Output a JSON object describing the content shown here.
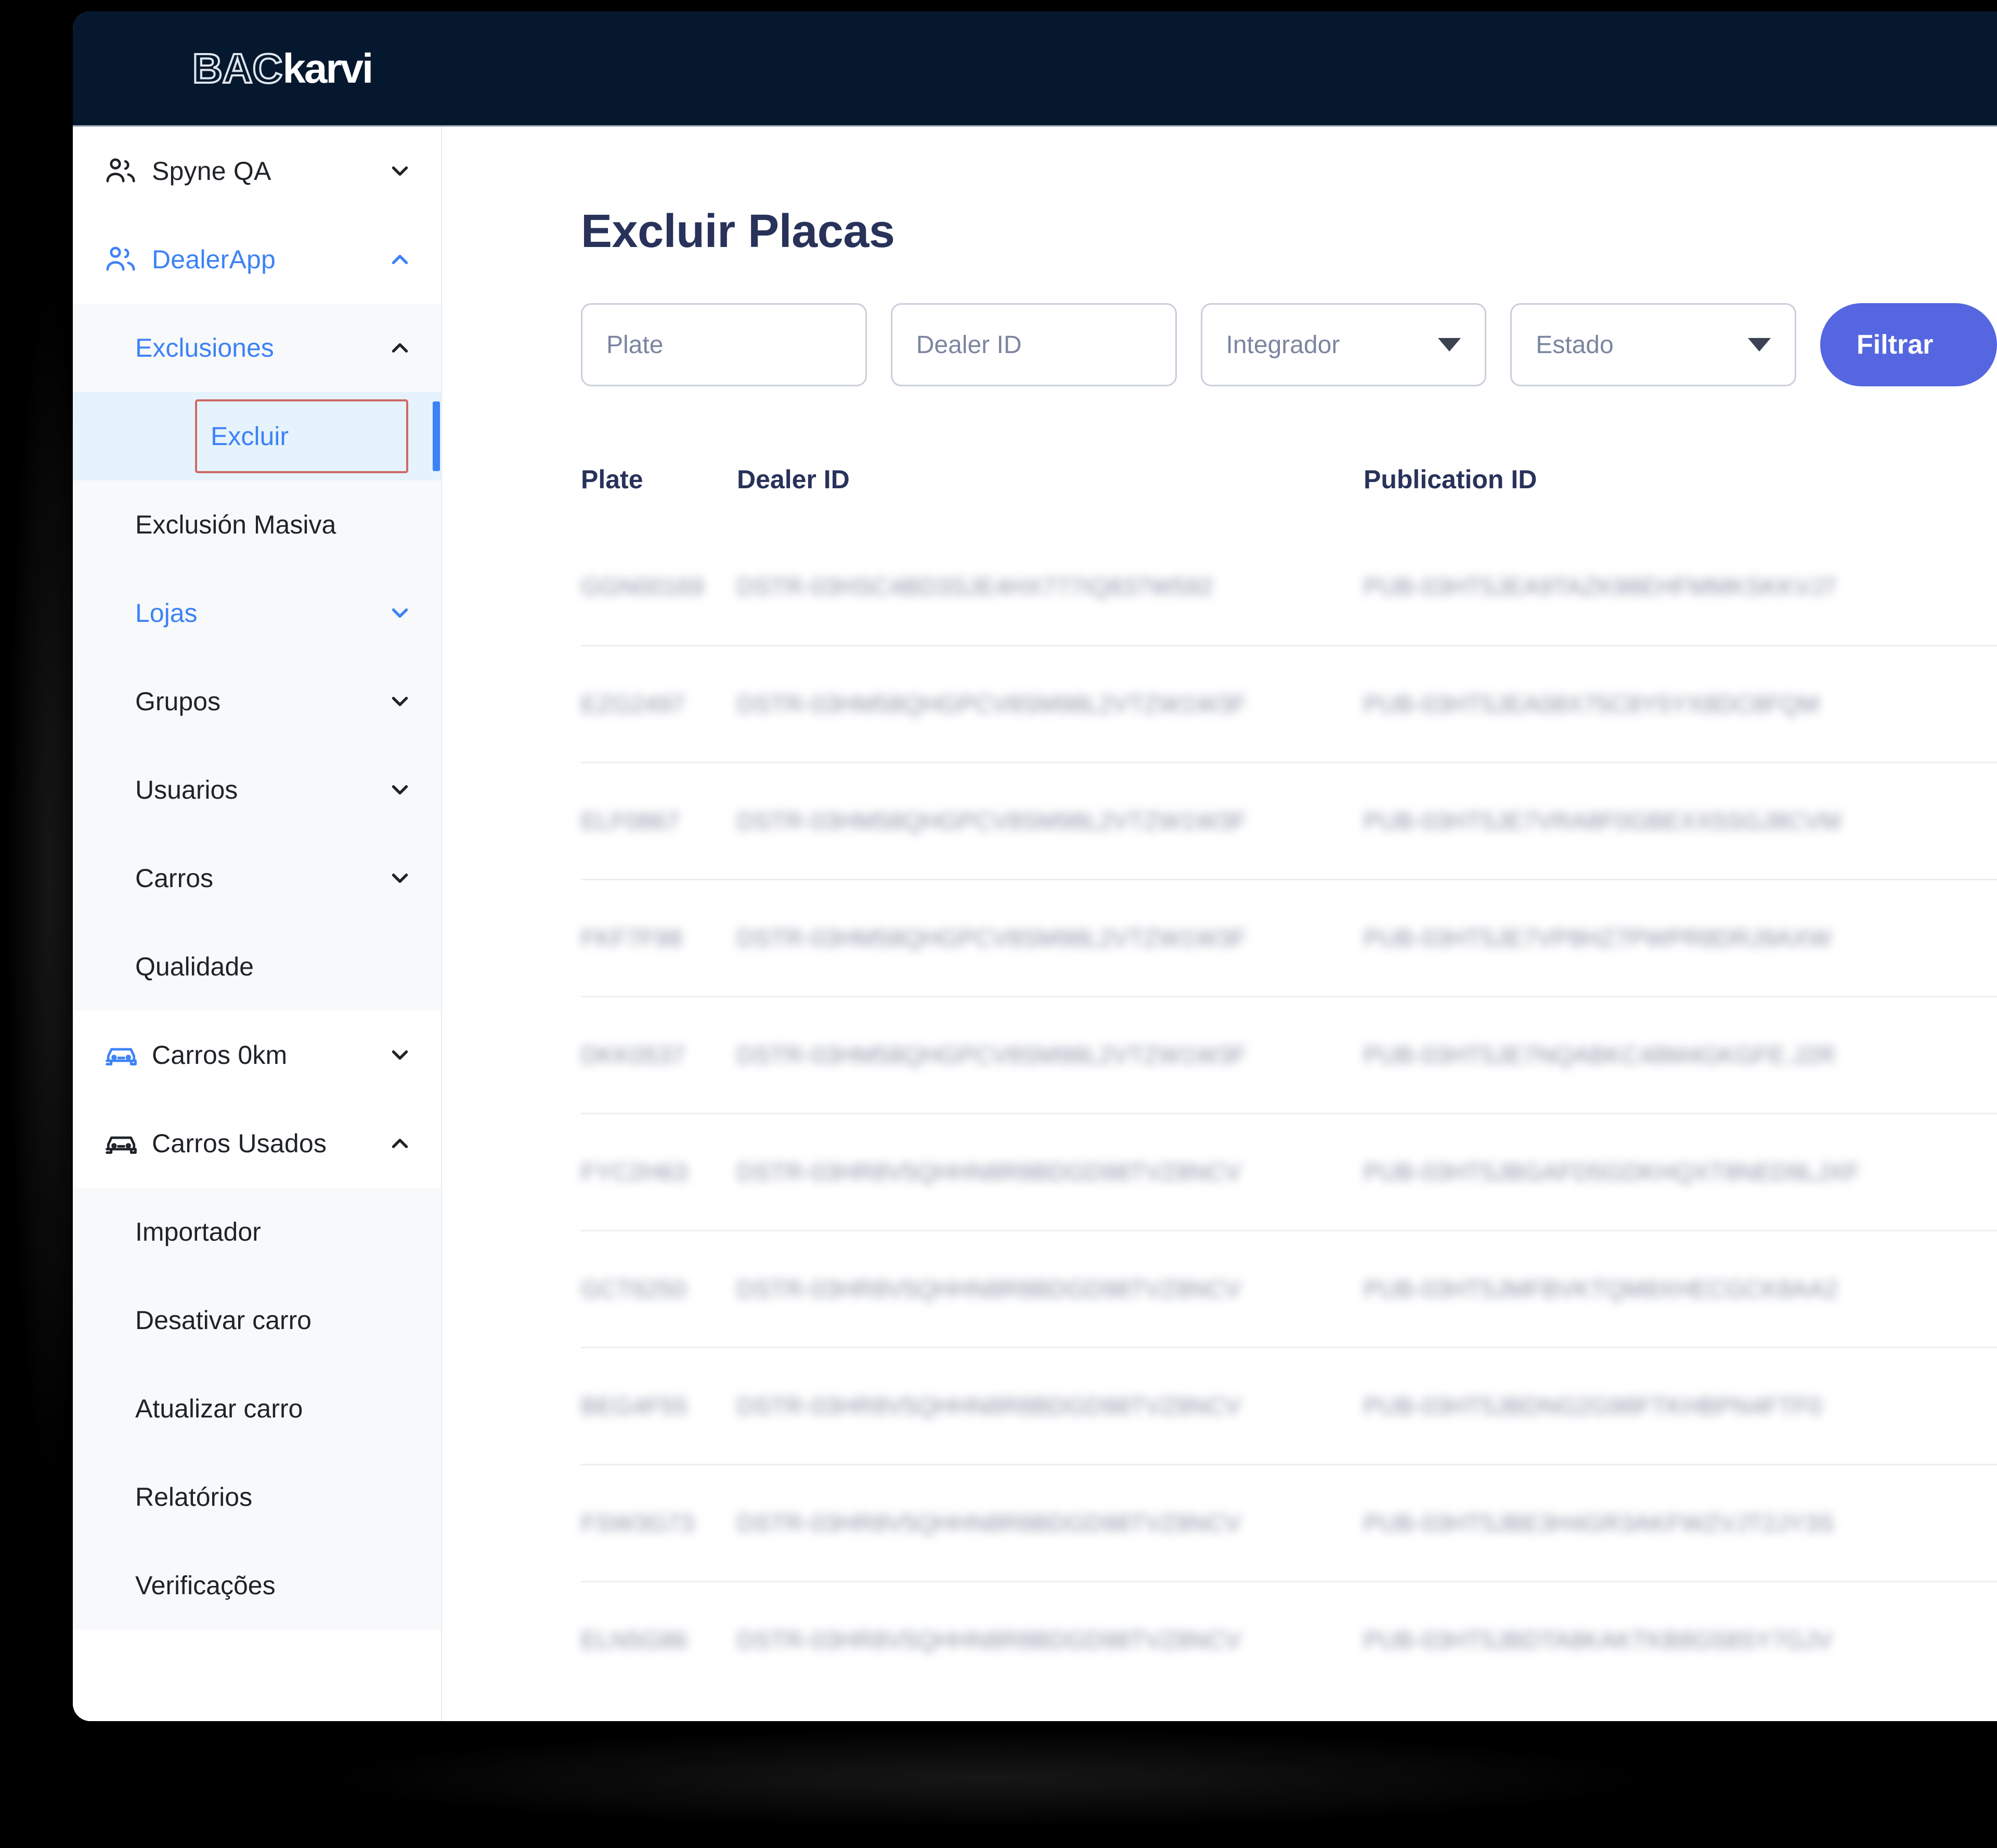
{
  "brand": {
    "part1": "BAC",
    "part2": "karvi"
  },
  "sidebar": {
    "items": [
      {
        "label": "Spyne QA",
        "icon": "users-icon",
        "chevron": "chevron-down-icon",
        "state": "collapsed",
        "accent": "dark"
      },
      {
        "label": "DealerApp",
        "icon": "users-icon",
        "chevron": "chevron-up-icon",
        "state": "expanded",
        "accent": "blue"
      }
    ],
    "dealerapp_children": [
      {
        "label": "Exclusiones",
        "chevron": "chevron-up-icon",
        "state": "expanded",
        "accent": "blue"
      },
      {
        "label": "Excluir",
        "state": "active",
        "accent": "blue"
      },
      {
        "label": "Exclusión Masiva",
        "accent": "dark"
      },
      {
        "label": "Lojas",
        "chevron": "chevron-down-icon",
        "state": "collapsed",
        "accent": "blue"
      },
      {
        "label": "Grupos",
        "chevron": "chevron-down-icon",
        "state": "collapsed",
        "accent": "dark"
      },
      {
        "label": "Usuarios",
        "chevron": "chevron-down-icon",
        "state": "collapsed",
        "accent": "dark"
      },
      {
        "label": "Carros",
        "chevron": "chevron-down-icon",
        "state": "collapsed",
        "accent": "dark"
      },
      {
        "label": "Qualidade",
        "accent": "dark"
      }
    ],
    "bottom_items": [
      {
        "label": "Carros 0km",
        "icon": "car-icon",
        "icon_color": "#3d82f6",
        "chevron": "chevron-down-icon",
        "state": "collapsed"
      },
      {
        "label": "Carros Usados",
        "icon": "car-icon",
        "icon_color": "#1f2328",
        "chevron": "chevron-up-icon",
        "state": "expanded"
      }
    ],
    "carros_usados_children": [
      {
        "label": "Importador"
      },
      {
        "label": "Desativar carro"
      },
      {
        "label": "Atualizar carro"
      },
      {
        "label": "Relatórios"
      },
      {
        "label": "Verificações"
      }
    ]
  },
  "main": {
    "title": "Excluir Placas",
    "filters": {
      "plate_placeholder": "Plate",
      "dealer_placeholder": "Dealer ID",
      "integrador_placeholder": "Integrador",
      "estado_placeholder": "Estado",
      "submit_label": "Filtrar"
    },
    "table": {
      "columns": [
        "Plate",
        "Dealer ID",
        "Publication ID"
      ],
      "rows": [
        {
          "plate": "GGN00169",
          "dealer_id": "DSTR-03HSC4BD3SJE4HX777IQ837W592",
          "publication_id": "PUB-03HT5JEA9TAZK98EHFMMKSKKVJ7"
        },
        {
          "plate": "EZG2497",
          "dealer_id": "DSTR-03HM58QHGPCV8SM98L2VTZW1W3F",
          "publication_id": "PUB-03HT5JEA08X75C8Y5YX8DC8FQM"
        },
        {
          "plate": "ELF0867",
          "dealer_id": "DSTR-03HM58QHGPCV8SM98L2VTZW1W3F",
          "publication_id": "PUB-03HT5JE7VRA8F0GBEXX5SGJ8CVM"
        },
        {
          "plate": "FKF7F98",
          "dealer_id": "DSTR-03HM58QHGPCV8SM98L2VTZW1W3F",
          "publication_id": "PUB-03HT5JE7VP8HZ7PWPR8DRJ9AXW"
        },
        {
          "plate": "DKK0537",
          "dealer_id": "DSTR-03HM58QHGPCV8SM98L2VTZW1W3F",
          "publication_id": "PUB-03HT5JE7NQABKC48M4GKGFE.J2R"
        },
        {
          "plate": "FYC2H63",
          "dealer_id": "DSTR-03HR8V5QHHN8R8BDGD98TVZ8NCV",
          "publication_id": "PUB-03HT5JBGAFD5GDKHQXT8NED9LJXF"
        },
        {
          "plate": "GCT6250",
          "dealer_id": "DSTR-03HR8V5QHHN8R8BDGD98TVZ8NCV",
          "publication_id": "PUB-03HT5JMFBVKTQM8XHECGCK8AA2"
        },
        {
          "plate": "BEG4F55",
          "dealer_id": "DSTR-03HR8V5QHHN8R8BDGD98TVZ8NCV",
          "publication_id": "PUB-03HT5JBDNG2G98FTKHBPN4FTF0"
        },
        {
          "plate": "FSW3G73",
          "dealer_id": "DSTR-03HR8V5QHHN8R8BDGD98TVZ8NCV",
          "publication_id": "PUB-03HT5JBE3H4GR3AKFWZVJT2JY3S"
        },
        {
          "plate": "ELN5G86",
          "dealer_id": "DSTR-03HR8V5QHHN8R8BDGD98TVZ8NCV",
          "publication_id": "PUB-03HT5JBDTA8KAKTKB8G58SY7GJV"
        }
      ]
    }
  }
}
